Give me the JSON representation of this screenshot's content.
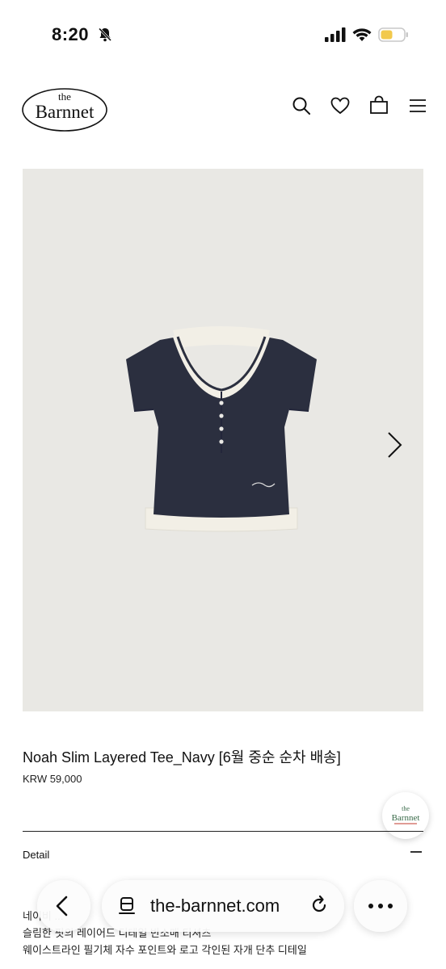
{
  "status_bar": {
    "time": "8:20",
    "icons": [
      "bell-slash-icon",
      "cellular-signal-icon",
      "wifi-icon",
      "battery-icon"
    ],
    "battery_color": "#f2c94c"
  },
  "header": {
    "logo_top": "the",
    "logo_main": "Barnnet",
    "icons": [
      "search-icon",
      "heart-icon",
      "shopping-bag-icon",
      "hamburger-menu-icon"
    ]
  },
  "gallery": {
    "background": "#e9e8e4",
    "shirt_color": "#2b2f3f",
    "layer_color": "#f2efe6",
    "next_icon": "chevron-right-icon"
  },
  "product": {
    "title": "Noah Slim Layered Tee_Navy [6월 중순 순차 배송]",
    "price": "KRW 59,000"
  },
  "fab": {
    "logo_top": "the",
    "logo_main": "Barnnet",
    "color": "#3a6b4a"
  },
  "detail": {
    "label": "Detail",
    "toggle_icon": "minus-icon"
  },
  "description": {
    "line1": "네이비 ...",
    "line2": "슬림한 핏의 레이어드 디테일 반소매 티셔츠",
    "line3": "웨이스트라인 필기체 자수 포인트와 로고 각인된 자개 단추 디테일"
  },
  "browser": {
    "url": "the-barnnet.com",
    "icons": [
      "back-arrow-icon",
      "tabs-icon",
      "reload-icon",
      "more-icon"
    ]
  }
}
